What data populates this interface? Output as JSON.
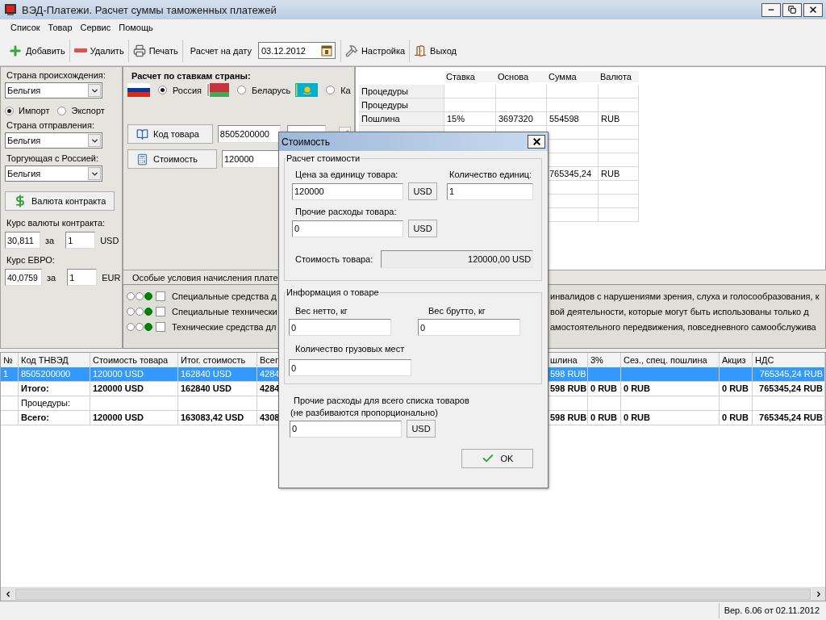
{
  "window": {
    "title": "ВЭД-Платежи. Расчет суммы таможенных платежей"
  },
  "menu": [
    "Список",
    "Товар",
    "Сервис",
    "Помощь"
  ],
  "toolbar": {
    "add": "Добавить",
    "delete": "Удалить",
    "print": "Печать",
    "date_label": "Расчет на дату",
    "date": "03.12.2012",
    "settings": "Настройка",
    "exit": "Выход"
  },
  "left_panel": {
    "origin_label": "Страна происхождения:",
    "origin": "Бельгия",
    "direction": [
      {
        "label": "Импорт",
        "selected": true
      },
      {
        "label": "Экспорт",
        "selected": false
      }
    ],
    "departure_label": "Страна отправления:",
    "departure": "Бельгия",
    "trading_label": "Торгующая с Россией:",
    "trading": "Бельгия",
    "currency_button": "Валюта контракта",
    "rate_label": "Курс валюты контракта:",
    "rate": {
      "value": "30,811",
      "per": "за",
      "units": "1",
      "currency": "USD"
    },
    "euro_label": "Курс ЕВРО:",
    "euro": {
      "value": "40,0759",
      "per": "за",
      "units": "1",
      "currency": "EUR"
    }
  },
  "calc_panel": {
    "title": "Расчет по ставкам страны:",
    "countries": [
      {
        "kind": "ru",
        "name": "Россия",
        "selected": true
      },
      {
        "kind": "by",
        "name": "Беларусь",
        "selected": false
      },
      {
        "kind": "kz",
        "name": "Ка",
        "selected": false
      }
    ],
    "code_button": "Код товара",
    "code": "8505200000",
    "cost_button": "Стоимость",
    "cost": "120000"
  },
  "rates_table": {
    "columns": [
      "Ставка",
      "Основа",
      "Сумма",
      "Валюта"
    ],
    "rows": [
      {
        "label": "Процедуры",
        "cells": [
          null,
          null,
          null,
          null
        ]
      },
      {
        "label": "Процедуры",
        "cells": [
          null,
          null,
          null,
          null
        ]
      },
      {
        "label": "Пошлина",
        "cells": [
          "15%",
          "3697320",
          "554598",
          "RUB"
        ]
      },
      {
        "label": null,
        "cells": [
          null,
          null,
          null,
          null
        ]
      },
      {
        "label": null,
        "cells": [
          null,
          null,
          null,
          null
        ]
      },
      {
        "label": null,
        "cells": [
          null,
          null,
          null,
          null
        ]
      },
      {
        "label": null,
        "cells": [
          null,
          null,
          "765345,24",
          "RUB"
        ]
      },
      {
        "label": null,
        "cells": [
          null,
          null,
          null,
          null
        ]
      },
      {
        "label": null,
        "cells": [
          null,
          null,
          null,
          null
        ]
      },
      {
        "label": null,
        "cells": [
          null,
          null,
          null,
          null
        ]
      }
    ]
  },
  "special_conditions": {
    "title": "Особые условия начисления плате",
    "rows": [
      {
        "color": "#008000",
        "checked": false,
        "text_left": "Специальные средства д",
        "text_right": "инвалидов с нарушениями зрения, слуха и голосообразования, к"
      },
      {
        "color": "#008000",
        "checked": false,
        "text_left": "Специальные технически",
        "text_right": "вой деятельности, которые могут быть использованы только д"
      },
      {
        "color": "#008000",
        "checked": false,
        "text_left": "Технические средства дл",
        "text_right": "амостоятельного передвижения, повседневного самообслужива"
      }
    ]
  },
  "goods_table": {
    "columns": [
      "№",
      "Код ТНВЭД",
      "Стоимость товара",
      "Итог. стоимость",
      "Всег",
      "шлина",
      "3%",
      "Сез., спец. пошлина",
      "Акциз",
      "НДС"
    ],
    "rows": [
      {
        "kind": "item",
        "selected": true,
        "cells": [
          "1",
          "8505200000",
          "120000 USD",
          "162840 USD",
          "4284",
          "598 RUB",
          null,
          null,
          null,
          "765345,24 RUB"
        ]
      },
      {
        "kind": "total",
        "selected": false,
        "cells": [
          null,
          "Итого:",
          "120000 USD",
          "162840 USD",
          "4284",
          "598 RUB",
          "0 RUB",
          "0 RUB",
          "0 RUB",
          "765345,24 RUB"
        ]
      },
      {
        "kind": "item",
        "selected": false,
        "cells": [
          null,
          "Процедуры:",
          null,
          null,
          null,
          null,
          null,
          null,
          null,
          null
        ]
      },
      {
        "kind": "total",
        "selected": false,
        "cells": [
          null,
          "Всего:",
          "120000 USD",
          "163083,42 USD",
          "4308",
          "598 RUB",
          "0 RUB",
          "0 RUB",
          "0 RUB",
          "765345,24 RUB"
        ]
      }
    ]
  },
  "status_bar": "Вер. 6.06 от 02.11.2012",
  "dialog": {
    "title": "Стоимость",
    "cost_group": {
      "title": "Расчет стоимости",
      "price_label": "Цена за единицу товара:",
      "price": "120000",
      "price_currency": "USD",
      "qty_label": "Количество единиц:",
      "qty": "1",
      "other_label": "Прочие расходы товара:",
      "other": "0",
      "other_currency": "USD",
      "total_label": "Стоимость товара:",
      "total": "120000,00 USD"
    },
    "info_group": {
      "title": "Информация о товаре",
      "net_label": "Вес нетто, кг",
      "net": "0",
      "gross_label": "Вес брутто, кг",
      "gross": "0",
      "places_label": "Количество грузовых мест",
      "places": "0"
    },
    "list_expenses_label": [
      "Прочие расходы для всего списка товаров",
      "(не разбиваются пропорционально)"
    ],
    "list_expenses": "0",
    "list_expenses_currency": "USD",
    "ok": "OK"
  }
}
